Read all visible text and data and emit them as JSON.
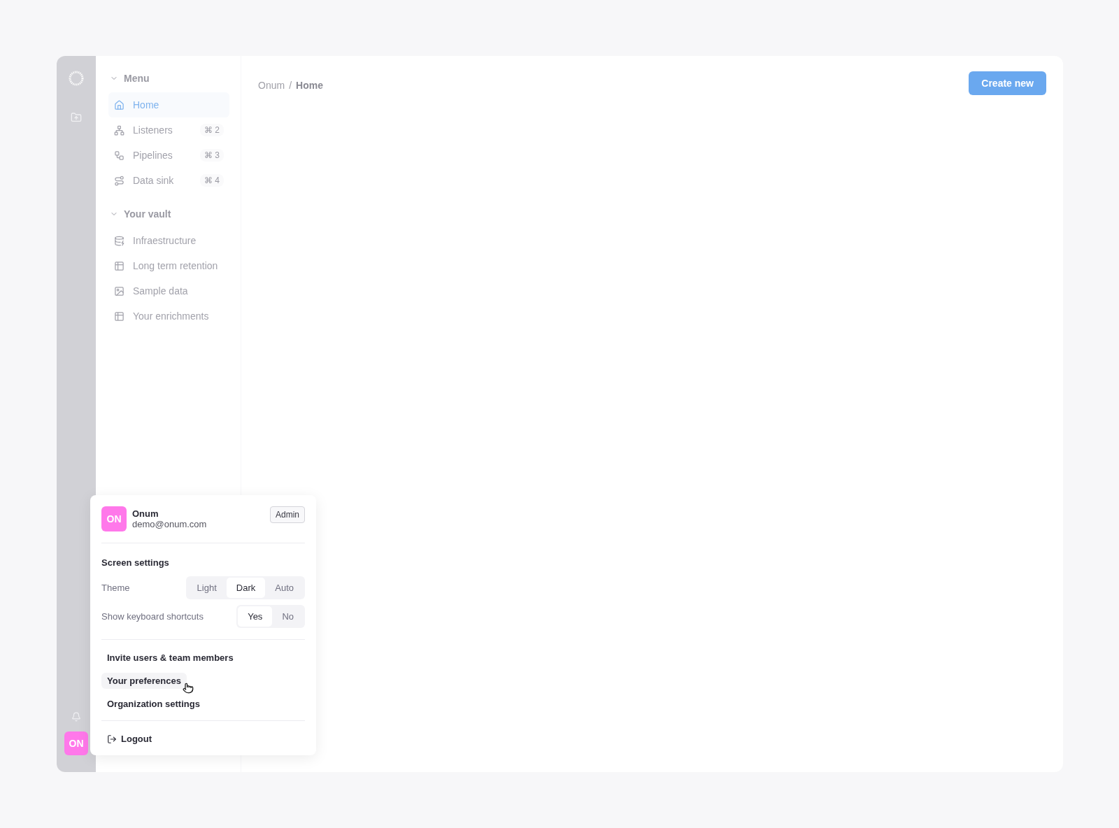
{
  "rail": {
    "avatar": "ON"
  },
  "sidebar": {
    "sections": [
      {
        "title": "Menu",
        "expanded": true,
        "items": [
          {
            "label": "Home",
            "selected": true
          },
          {
            "label": "Listeners",
            "shortcut": "⌘ 2",
            "selected": false
          },
          {
            "label": "Pipelines",
            "shortcut": "⌘ 3",
            "selected": false
          },
          {
            "label": "Data sink",
            "shortcut": "⌘ 4",
            "selected": false
          }
        ]
      },
      {
        "title": "Your vault",
        "expanded": true,
        "items": [
          {
            "label": "Infraestructure",
            "selected": false
          },
          {
            "label": "Long term retention",
            "selected": false
          },
          {
            "label": "Sample data",
            "selected": false
          },
          {
            "label": "Your enrichments",
            "selected": false
          }
        ]
      }
    ]
  },
  "breadcrumb": {
    "parent": "Onum",
    "separator": "/",
    "current": "Home"
  },
  "create_button": "Create new",
  "user_menu": {
    "avatar": "ON",
    "name": "Onum",
    "email": "demo@onum.com",
    "role": "Admin",
    "settings_title": "Screen settings",
    "settings": [
      {
        "label": "Theme",
        "options": [
          {
            "label": "Light",
            "selected": false
          },
          {
            "label": "Dark",
            "selected": true
          },
          {
            "label": "Auto",
            "selected": false
          }
        ]
      },
      {
        "label": "Show keyboard shortcuts",
        "options": [
          {
            "label": "Yes",
            "selected": true
          },
          {
            "label": "No",
            "selected": false
          }
        ]
      }
    ],
    "links": [
      {
        "label": "Invite users & team members",
        "hovered": false
      },
      {
        "label": "Your preferences",
        "hovered": true
      },
      {
        "label": "Organization settings",
        "hovered": false
      }
    ],
    "logout": "Logout"
  }
}
